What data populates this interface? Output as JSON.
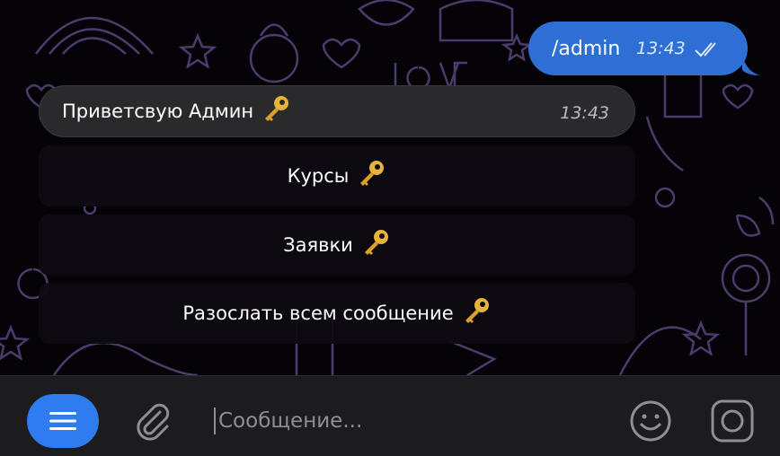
{
  "outgoing": {
    "text": "/admin",
    "time": "13:43",
    "status_icon": "double-check-icon"
  },
  "incoming": {
    "text": "Приветсвую Админ",
    "emoji": "key",
    "time": "13:43"
  },
  "keyboard": [
    {
      "label": "Курсы",
      "emoji": "key"
    },
    {
      "label": "Заявки",
      "emoji": "key"
    },
    {
      "label": "Разослать всем сообщение",
      "emoji": "key"
    }
  ],
  "input_bar": {
    "menu_icon": "menu-icon",
    "attach_icon": "paperclip-icon",
    "placeholder": "Сообщение...",
    "emoji_icon": "smiley-icon",
    "sticker_icon": "sticker-icon"
  },
  "colors": {
    "outgoing_bubble": "#2e6fd6",
    "incoming_bubble": "#2a2a2c",
    "menu_button": "#2f7bf0",
    "doodle": "#4a3a6a"
  }
}
